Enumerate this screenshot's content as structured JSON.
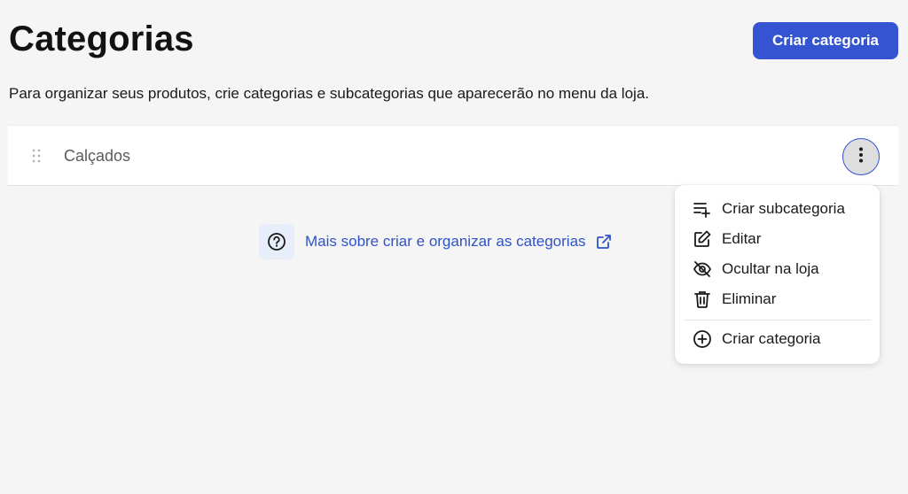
{
  "header": {
    "title": "Categorias",
    "create_button_label": "Criar categoria",
    "subtitle": "Para organizar seus produtos, crie categorias e subcategorias que aparecerão no menu da loja."
  },
  "categories": [
    {
      "name": "Calçados",
      "drag_icon": "drag-handle-icon",
      "actions_icon": "kebab-menu-icon"
    }
  ],
  "help": {
    "text": "Mais sobre criar e organizar as categorias",
    "icon": "question-circle-icon",
    "trailing_icon": "external-link-icon"
  },
  "menu": {
    "items": [
      {
        "label": "Criar subcategoria",
        "icon": "list-add-icon"
      },
      {
        "label": "Editar",
        "icon": "edit-icon"
      },
      {
        "label": "Ocultar na loja",
        "icon": "eye-off-icon"
      },
      {
        "label": "Eliminar",
        "icon": "trash-icon"
      }
    ],
    "footer_item": {
      "label": "Criar categoria",
      "icon": "plus-circle-icon"
    }
  },
  "colors": {
    "primary": "#3454d1",
    "link": "#2f52c7",
    "background": "#f5f5f6"
  }
}
